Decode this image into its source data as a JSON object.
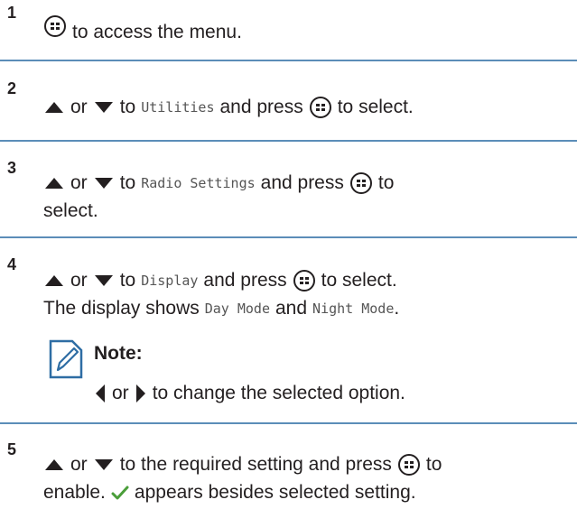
{
  "steps": [
    {
      "number": "1",
      "text": "to access the menu."
    },
    {
      "number": "2",
      "or": "or",
      "to": "to",
      "item": "Utilities",
      "and_press": "and press",
      "end": "to select."
    },
    {
      "number": "3",
      "or": "or",
      "to": "to",
      "item": "Radio Settings",
      "and_press": "and press",
      "end": "to",
      "end2": "select."
    },
    {
      "number": "4",
      "or": "or",
      "to": "to",
      "item": "Display",
      "and_press": "and press",
      "end": "to select.",
      "line2_start": "The display shows",
      "mode1": "Day Mode",
      "and": "and",
      "mode2": "Night Mode",
      "line2_end": ".",
      "note_title": "Note:",
      "note_or": "or",
      "note_text": "to change the selected option."
    },
    {
      "number": "5",
      "or": "or",
      "to": "to the required setting and press",
      "end": "to",
      "line2_start": "enable.",
      "line2_end": "appears besides selected setting."
    }
  ],
  "icons": {
    "menu_ok": "menu-ok-button-icon",
    "up": "up-arrow-icon",
    "down": "down-arrow-icon",
    "left": "left-arrow-icon",
    "right": "right-arrow-icon",
    "note": "note-pencil-icon",
    "check": "checkmark-icon"
  },
  "colors": {
    "separator": "#5b8db8",
    "check": "#4a9e3a",
    "note_icon": "#2e6da4"
  }
}
